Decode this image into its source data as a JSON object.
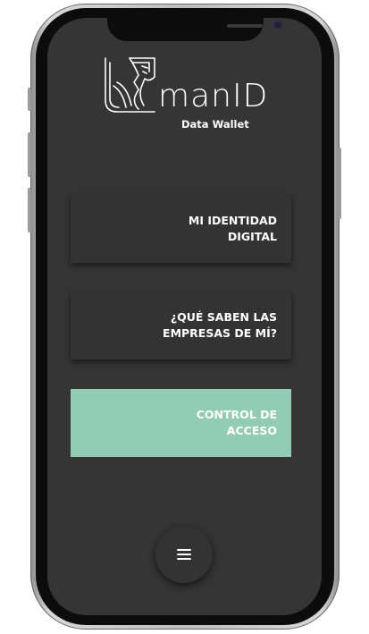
{
  "app": {
    "logo_text": "manID",
    "logo_subtitle": "Data Wallet"
  },
  "menu": {
    "items": [
      {
        "label": "MI IDENTIDAD DIGITAL",
        "active": false
      },
      {
        "label": "¿QUÉ SABEN LAS EMPRESAS DE MÍ?",
        "active": false
      },
      {
        "label": "CONTROL DE ACCESO",
        "active": true
      }
    ],
    "active_color": "#93ccb4",
    "button_color": "#333333"
  },
  "fab": {
    "icon": "hamburger-menu-icon"
  },
  "colors": {
    "screen_background": "#353535",
    "text": "#ffffff"
  }
}
